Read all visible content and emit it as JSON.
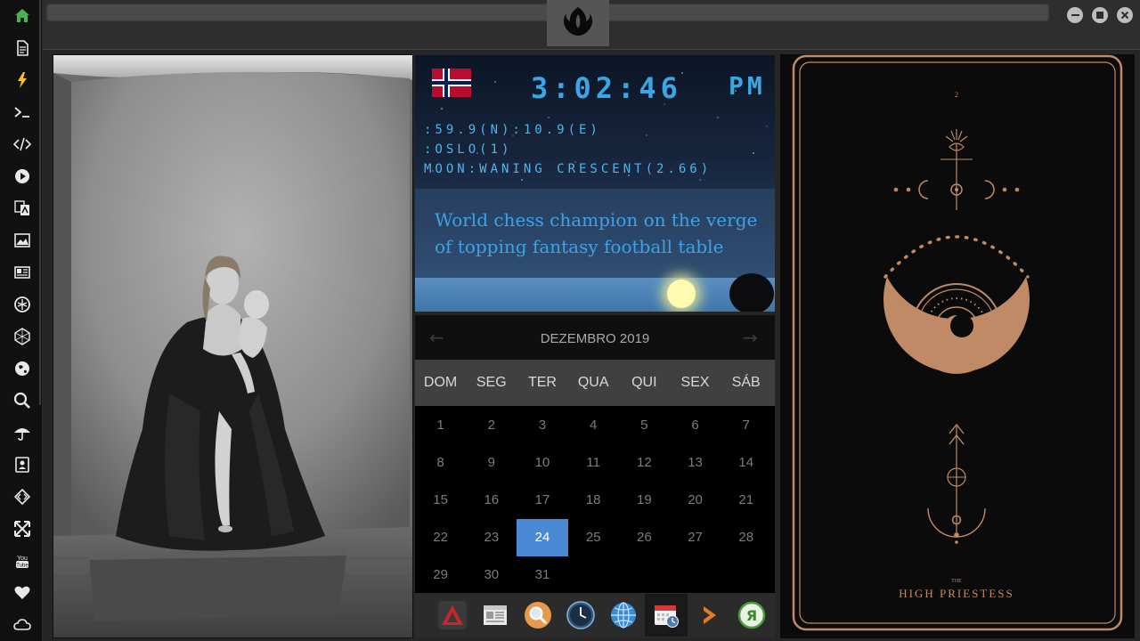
{
  "sidebar": {
    "items": [
      {
        "icon": "home-icon",
        "color": "#4caf50"
      },
      {
        "icon": "document-icon"
      },
      {
        "icon": "lightning-icon"
      },
      {
        "icon": "terminal-icon"
      },
      {
        "icon": "code-icon"
      },
      {
        "icon": "play-icon"
      },
      {
        "icon": "translate-icon"
      },
      {
        "icon": "image-icon"
      },
      {
        "icon": "newspaper-icon"
      },
      {
        "icon": "rebel-alliance-icon"
      },
      {
        "icon": "hexagon-icon"
      },
      {
        "icon": "globe-icon"
      },
      {
        "icon": "search-icon"
      },
      {
        "icon": "umbrella-icon"
      },
      {
        "icon": "contact-icon"
      },
      {
        "icon": "diamond-code-icon"
      },
      {
        "icon": "expand-icon"
      },
      {
        "icon": "youtube-icon"
      },
      {
        "icon": "heart-icon"
      },
      {
        "icon": "cloud-icon"
      }
    ]
  },
  "topbar": {
    "logo": "rebel-alliance-icon",
    "window_buttons": [
      "minimize-icon",
      "maximize-icon",
      "close-icon"
    ]
  },
  "clock": {
    "flag": "norway-flag",
    "time": "3:02:46",
    "ampm": "PM",
    "coordinates": ":59.9(N):10.9(E)",
    "location": ":OSLO(1)",
    "moon_phase": "MOON:WANING CRESCENT(2.66)",
    "headline": "World chess champion on the verge of topping fantasy football table",
    "accent_color": "#3aa6e6"
  },
  "calendar": {
    "title": "DEZEMBRO 2019",
    "prev": "←",
    "next": "→",
    "weekdays": [
      "DOM",
      "SEG",
      "TER",
      "QUA",
      "QUI",
      "SEX",
      "SÁB"
    ],
    "weeks": [
      [
        "1",
        "2",
        "3",
        "4",
        "5",
        "6",
        "7"
      ],
      [
        "8",
        "9",
        "10",
        "11",
        "12",
        "13",
        "14"
      ],
      [
        "15",
        "16",
        "17",
        "18",
        "19",
        "20",
        "21"
      ],
      [
        "22",
        "23",
        "24",
        "25",
        "26",
        "27",
        "28"
      ],
      [
        "29",
        "30",
        "31",
        "",
        "",
        "",
        ""
      ]
    ],
    "today": "24",
    "today_color": "#4a8ad4"
  },
  "dock": {
    "items": [
      "red-triangle-app-icon",
      "newspaper-app-icon",
      "search-app-icon",
      "clock-app-icon",
      "globe-app-icon",
      "calendar-app-icon",
      "arrow-app-icon",
      "yandex-app-icon"
    ],
    "active": "calendar-app-icon"
  },
  "tarot": {
    "number": "2",
    "the": "THE",
    "name": "HIGH PRIESTESS",
    "line_color": "#c08a66"
  }
}
